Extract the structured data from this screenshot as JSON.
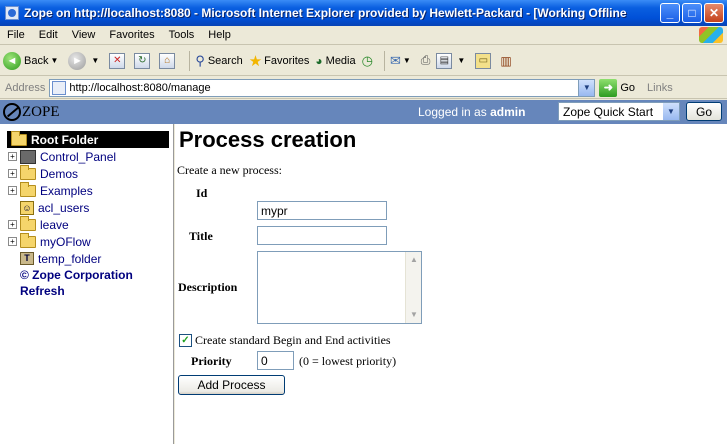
{
  "window": {
    "title": "Zope on http://localhost:8080 - Microsoft Internet Explorer provided by Hewlett-Packard - [Working Offline"
  },
  "menu": [
    "File",
    "Edit",
    "View",
    "Favorites",
    "Tools",
    "Help"
  ],
  "toolbar": {
    "back": "Back",
    "search": "Search",
    "favorites": "Favorites",
    "media": "Media"
  },
  "address": {
    "label": "Address",
    "url": "http://localhost:8080/manage",
    "go": "Go",
    "links": "Links"
  },
  "zope_header": {
    "logo": "ZOPE",
    "logged_prefix": "Logged in as",
    "user": "admin",
    "quick_start": "Zope Quick Start",
    "go": "Go"
  },
  "tree": {
    "root": "Root Folder",
    "items": [
      {
        "label": "Control_Panel",
        "expandable": true,
        "icon": "control-panel-icon"
      },
      {
        "label": "Demos",
        "expandable": true,
        "icon": "folder-icon"
      },
      {
        "label": "Examples",
        "expandable": true,
        "icon": "folder-icon"
      },
      {
        "label": "acl_users",
        "expandable": false,
        "icon": "user-folder-icon"
      },
      {
        "label": "leave",
        "expandable": true,
        "icon": "folder-icon"
      },
      {
        "label": "myOFlow",
        "expandable": true,
        "icon": "folder-icon"
      },
      {
        "label": "temp_folder",
        "expandable": false,
        "icon": "temp-folder-icon"
      }
    ],
    "copyright": "© Zope Corporation",
    "refresh": "Refresh"
  },
  "form": {
    "heading": "Process creation",
    "subtitle": "Create a new process:",
    "id_label": "Id",
    "id_value": "mypr",
    "title_label": "Title",
    "title_value": "",
    "description_label": "Description",
    "checkbox_label": "Create standard Begin and End activities",
    "checkbox_checked": true,
    "priority_label": "Priority",
    "priority_value": "0",
    "priority_hint": "(0 = lowest priority)",
    "submit": "Add Process"
  }
}
